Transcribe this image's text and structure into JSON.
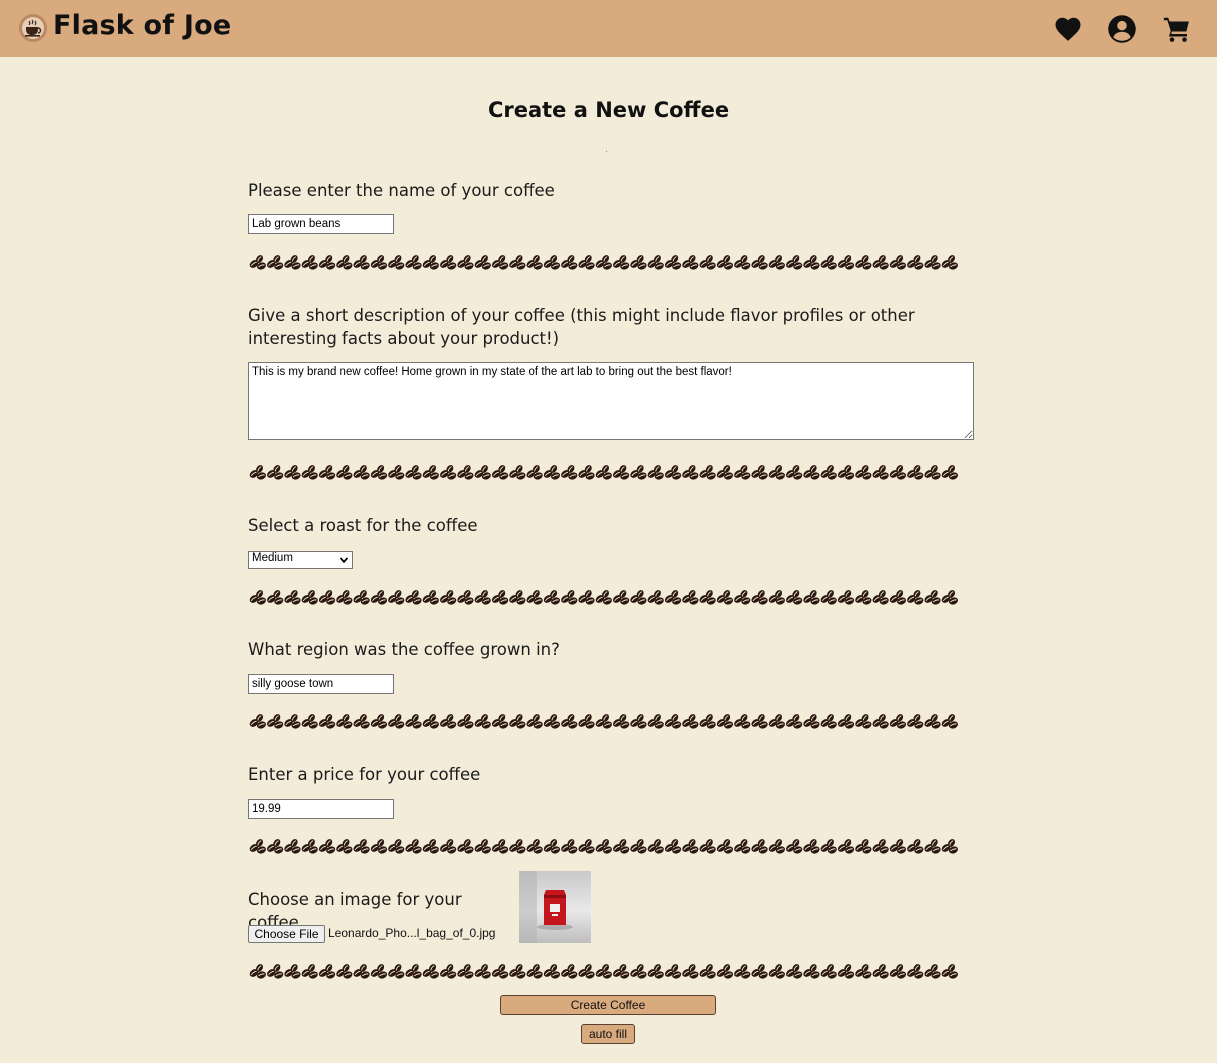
{
  "header": {
    "brand": "Flask of Joe",
    "logo_icon": "coffee-cup-icon",
    "icons": [
      "heart-icon",
      "user-circle-icon",
      "shopping-cart-icon"
    ],
    "background_color": "#d8aa7e"
  },
  "page": {
    "title": "Create a New Coffee",
    "background_color": "#f2ecd9",
    "divider_icon": "coffee-beans-icon",
    "divider_color": "#2b1710"
  },
  "form": {
    "name": {
      "label": "Please enter the name of your coffee",
      "value": "Lab grown beans"
    },
    "description": {
      "label": "Give a short description of your coffee (this might include flavor profiles or other interesting facts about your product!)",
      "value": "This is my brand new coffee! Home grown in my state of the art lab to bring out the best flavor!"
    },
    "roast": {
      "label": "Select a roast for the coffee",
      "selected": "Medium"
    },
    "region": {
      "label": "What region was the coffee grown in?",
      "value": "silly goose town"
    },
    "price": {
      "label": "Enter a price for your coffee",
      "value": "19.99"
    },
    "image": {
      "label": "Choose an image for your coffee",
      "button_label": "Choose File",
      "file_name": "Leonardo_Pho...l_bag_of_0.jpg"
    },
    "submit_label": "Create Coffee",
    "autofill_label": "auto fill"
  }
}
